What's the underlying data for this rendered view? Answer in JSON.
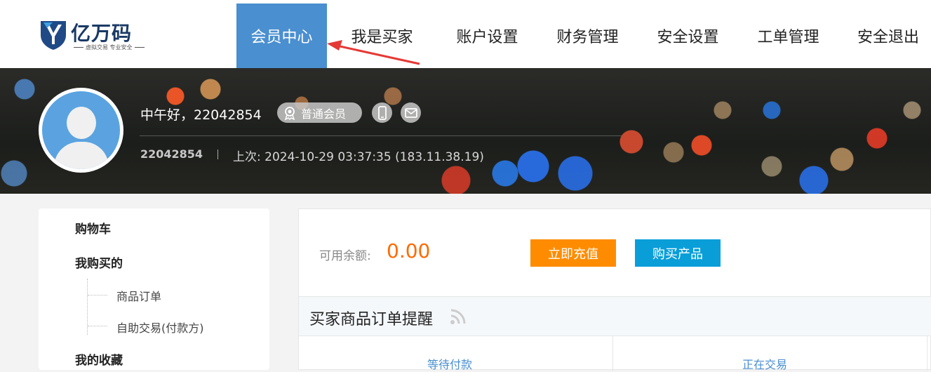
{
  "header": {
    "logo_name": "亿万码",
    "logo_slogan": "虚拟交易  专业安全",
    "nav": [
      {
        "label": "会员中心",
        "active": true
      },
      {
        "label": "我是买家",
        "active": false
      },
      {
        "label": "账户设置",
        "active": false
      },
      {
        "label": "财务管理",
        "active": false
      },
      {
        "label": "安全设置",
        "active": false
      },
      {
        "label": "工单管理",
        "active": false
      },
      {
        "label": "安全退出",
        "active": false
      }
    ],
    "accent_color": "#4a8fd0",
    "annotation_arrow_color": "#e53935"
  },
  "profile": {
    "greeting": "中午好，22042854",
    "member_level": "普通会员",
    "user_id": "22042854",
    "last_login": "上次: 2024-10-29 03:37:35 (183.11.38.19)",
    "icons": [
      "medal-icon",
      "phone-icon",
      "mail-icon"
    ]
  },
  "sidebar": {
    "sections": [
      {
        "label": "购物车"
      },
      {
        "label": "我购买的",
        "items": [
          "商品订单",
          "自助交易(付款方)"
        ]
      },
      {
        "label": "我的收藏"
      }
    ]
  },
  "main": {
    "balance_label": "可用余额:",
    "balance_value": "0.00",
    "balance_color": "#ff6a00",
    "recharge_label": "立即充值",
    "buy_label": "购买产品",
    "section_title": "买家商品订单提醒",
    "stats_labels": [
      "等待付款",
      "正在交易"
    ]
  }
}
